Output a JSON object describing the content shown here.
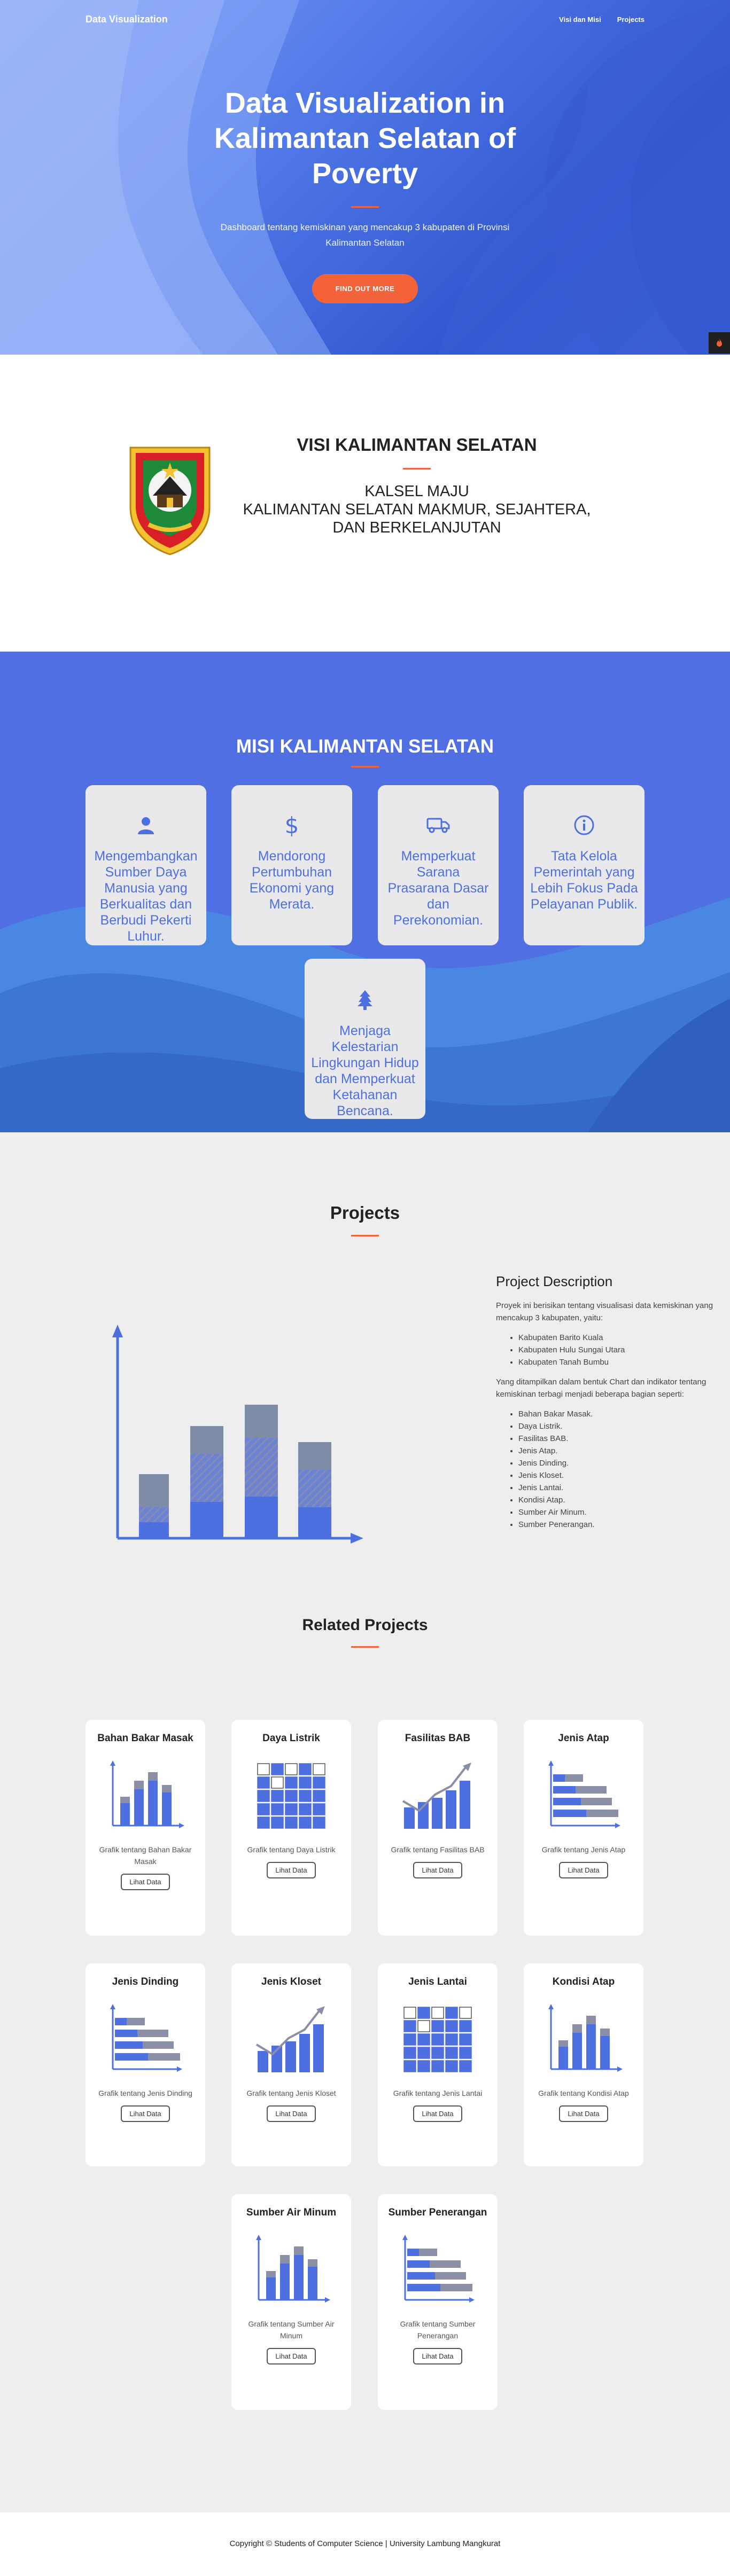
{
  "nav": {
    "brand": "Data Visualization",
    "links": [
      "Visi dan Misi",
      "Projects"
    ]
  },
  "hero": {
    "title": "Data Visualization in Kalimantan Selatan of Poverty",
    "subtitle": "Dashboard tentang kemiskinan yang mencakup 3 kabupaten di Provinsi Kalimantan Selatan",
    "button": "FIND OUT MORE"
  },
  "visi": {
    "title": "VISI KALIMANTAN SELATAN",
    "line1": "KALSEL MAJU",
    "line2": "KALIMANTAN SELATAN MAKMUR, SEJAHTERA, DAN BERKELANJUTAN"
  },
  "misi": {
    "title": "MISI KALIMANTAN SELATAN",
    "items": [
      {
        "icon": "user-icon",
        "text": "Mengembangkan Sumber Daya Manusia yang Berkualitas dan Berbudi Pekerti Luhur."
      },
      {
        "icon": "dollar-icon",
        "text": "Mendorong Pertumbuhan Ekonomi yang Merata."
      },
      {
        "icon": "truck-icon",
        "text": "Memperkuat Sarana Prasarana Dasar dan Perekonomian."
      },
      {
        "icon": "info-icon",
        "text": "Tata Kelola Pemerintah yang Lebih Fokus Pada Pelayanan Publik."
      },
      {
        "icon": "tree-icon",
        "text": "Menjaga Kelestarian Lingkungan Hidup dan Memperkuat Ketahanan Bencana."
      }
    ]
  },
  "projects": {
    "title": "Projects",
    "desc_title": "Project Description",
    "desc_intro": "Proyek ini berisikan tentang visualisasi data kemiskinan yang mencakup 3 kabupaten, yaitu:",
    "kabupaten": [
      "Kabupaten Barito Kuala",
      "Kabupaten Hulu Sungai Utara",
      "Kabupaten Tanah Bumbu"
    ],
    "desc_mid": "Yang ditampilkan dalam bentuk Chart dan indikator tentang kemiskinan terbagi menjadi beberapa bagian seperti:",
    "indikator": [
      "Bahan Bakar Masak.",
      "Daya Listrik.",
      "Fasilitas BAB.",
      "Jenis Atap.",
      "Jenis Dinding.",
      "Jenis Kloset.",
      "Jenis Lantai.",
      "Kondisi Atap.",
      "Sumber Air Minum.",
      "Sumber Penerangan."
    ]
  },
  "related": {
    "title": "Related Projects",
    "button": "Lihat Data",
    "cards": [
      {
        "title": "Bahan Bakar Masak",
        "desc": "Grafik tentang Bahan Bakar Masak",
        "icon": "bar-chart-icon"
      },
      {
        "title": "Daya Listrik",
        "desc": "Grafik tentang Daya Listrik",
        "icon": "grid-icon"
      },
      {
        "title": "Fasilitas BAB",
        "desc": "Grafik tentang Fasilitas BAB",
        "icon": "trend-chart-icon"
      },
      {
        "title": "Jenis Atap",
        "desc": "Grafik tentang Jenis Atap",
        "icon": "horizontal-bar-icon"
      },
      {
        "title": "Jenis Dinding",
        "desc": "Grafik tentang Jenis Dinding",
        "icon": "horizontal-bar-icon"
      },
      {
        "title": "Jenis Kloset",
        "desc": "Grafik tentang Jenis Kloset",
        "icon": "trend-chart-icon"
      },
      {
        "title": "Jenis Lantai",
        "desc": "Grafik tentang Jenis Lantai",
        "icon": "grid-icon"
      },
      {
        "title": "Kondisi Atap",
        "desc": "Grafik tentang Kondisi Atap",
        "icon": "bar-chart-icon"
      },
      {
        "title": "Sumber Air Minum",
        "desc": "Grafik tentang Sumber Air Minum",
        "icon": "bar-chart-icon"
      },
      {
        "title": "Sumber Penerangan",
        "desc": "Grafik tentang Sumber Penerangan",
        "icon": "horizontal-bar-icon"
      }
    ]
  },
  "footer": {
    "text": "Copyright © Students of Computer Science | University Lambung Mangkurat"
  },
  "colors": {
    "accent": "#f4623a",
    "primary": "#4e6fe0"
  }
}
